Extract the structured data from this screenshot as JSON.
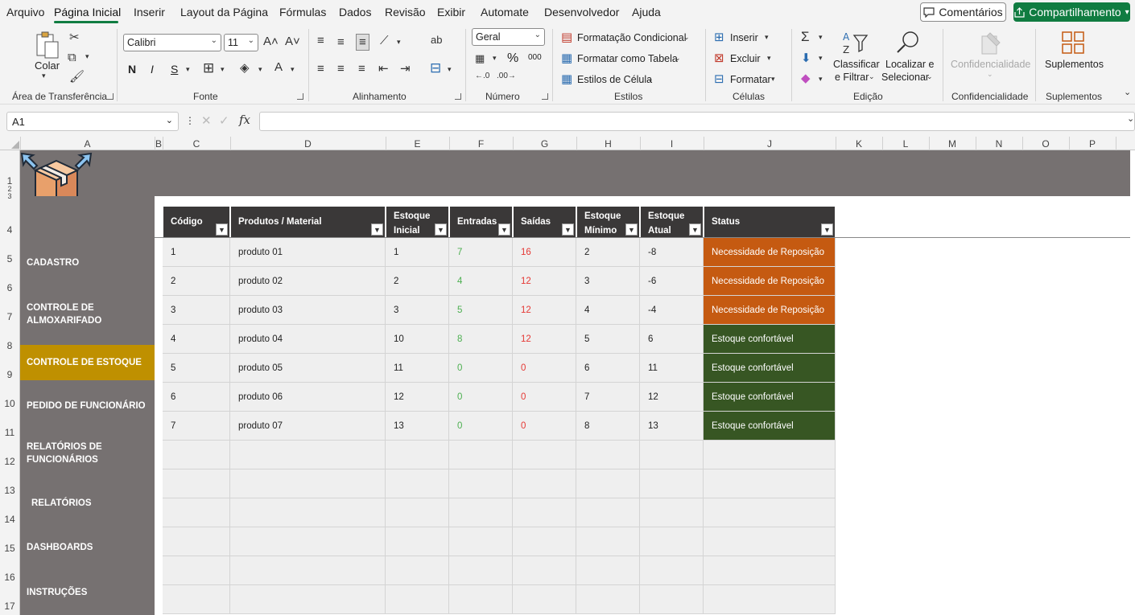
{
  "menu": {
    "items": [
      "Arquivo",
      "Página Inicial",
      "Inserir",
      "Layout da Página",
      "Fórmulas",
      "Dados",
      "Revisão",
      "Exibir",
      "Automate",
      "Desenvolvedor",
      "Ajuda"
    ],
    "comments_label": "Comentários",
    "share_label": "Compartilhamento"
  },
  "ribbon": {
    "clipboard": {
      "paste_label": "Colar",
      "group_label": "Área de Transferência"
    },
    "font": {
      "name": "Calibri",
      "size": "11",
      "group_label": "Fonte",
      "bold": "N",
      "italic": "I",
      "underline": "S"
    },
    "alignment": {
      "group_label": "Alinhamento"
    },
    "number": {
      "format": "Geral",
      "group_label": "Número",
      "percent": "%",
      "thousands": "000"
    },
    "styles": {
      "conditional": "Formatação Condicional",
      "table": "Formatar como Tabela",
      "cell": "Estilos de Célula",
      "group_label": "Estilos"
    },
    "cells": {
      "insert": "Inserir",
      "delete": "Excluir",
      "format": "Formatar",
      "group_label": "Células"
    },
    "editing": {
      "sort_line1": "Classificar",
      "sort_line2": "e Filtrar",
      "find_line1": "Localizar e",
      "find_line2": "Selecionar",
      "group_label": "Edição"
    },
    "sensitivity": {
      "label": "Confidencialidade",
      "group_label": "Confidencialidade"
    },
    "addins": {
      "label": "Suplementos",
      "group_label": "Suplementos"
    }
  },
  "formula_bar": {
    "cell_ref": "A1",
    "fx": "fx",
    "value": ""
  },
  "columns": [
    "A",
    "B",
    "C",
    "D",
    "E",
    "F",
    "G",
    "H",
    "I",
    "J",
    "K",
    "L",
    "M",
    "N",
    "O",
    "P"
  ],
  "rows": [
    "1",
    "2",
    "3",
    "4",
    "5",
    "6",
    "7",
    "8",
    "9",
    "10",
    "11",
    "12",
    "13",
    "14",
    "15",
    "16",
    "17"
  ],
  "sidebar": {
    "items": [
      {
        "label": "CADASTRO"
      },
      {
        "label": "CONTROLE DE ALMOXARIFADO"
      },
      {
        "label": "CONTROLE DE ESTOQUE"
      },
      {
        "label": "PEDIDO DE FUNCIONÁRIO"
      },
      {
        "label": "RELATÓRIOS DE FUNCIONÁRIOS"
      },
      {
        "label": "RELATÓRIOS"
      },
      {
        "label": "DASHBOARDS"
      },
      {
        "label": "INSTRUÇÕES"
      }
    ],
    "active_index": 2
  },
  "table": {
    "headers": [
      "Código",
      "Produtos / Material",
      "Estoque Inicial",
      "Entradas",
      "Saídas",
      "Estoque Mínimo",
      "Estoque Atual",
      "Status"
    ],
    "rows": [
      [
        "1",
        "produto 01",
        "1",
        "7",
        "16",
        "2",
        "-8",
        "Necessidade de Reposição"
      ],
      [
        "2",
        "produto 02",
        "2",
        "4",
        "12",
        "3",
        "-6",
        "Necessidade de Reposição"
      ],
      [
        "3",
        "produto 03",
        "3",
        "5",
        "12",
        "4",
        "-4",
        "Necessidade de Reposição"
      ],
      [
        "4",
        "produto 04",
        "10",
        "8",
        "12",
        "5",
        "6",
        "Estoque confortável"
      ],
      [
        "5",
        "produto 05",
        "11",
        "0",
        "0",
        "6",
        "11",
        "Estoque confortável"
      ],
      [
        "6",
        "produto 06",
        "12",
        "0",
        "0",
        "7",
        "12",
        "Estoque confortável"
      ],
      [
        "7",
        "produto 07",
        "13",
        "0",
        "0",
        "8",
        "13",
        "Estoque confortável"
      ]
    ],
    "empty_rows": 6
  },
  "colors": {
    "accent": "#107c41",
    "sidebar": "#767171",
    "active": "#bf9000",
    "header": "#3a3838",
    "status_bad": "#c55a11",
    "status_ok": "#375623"
  }
}
